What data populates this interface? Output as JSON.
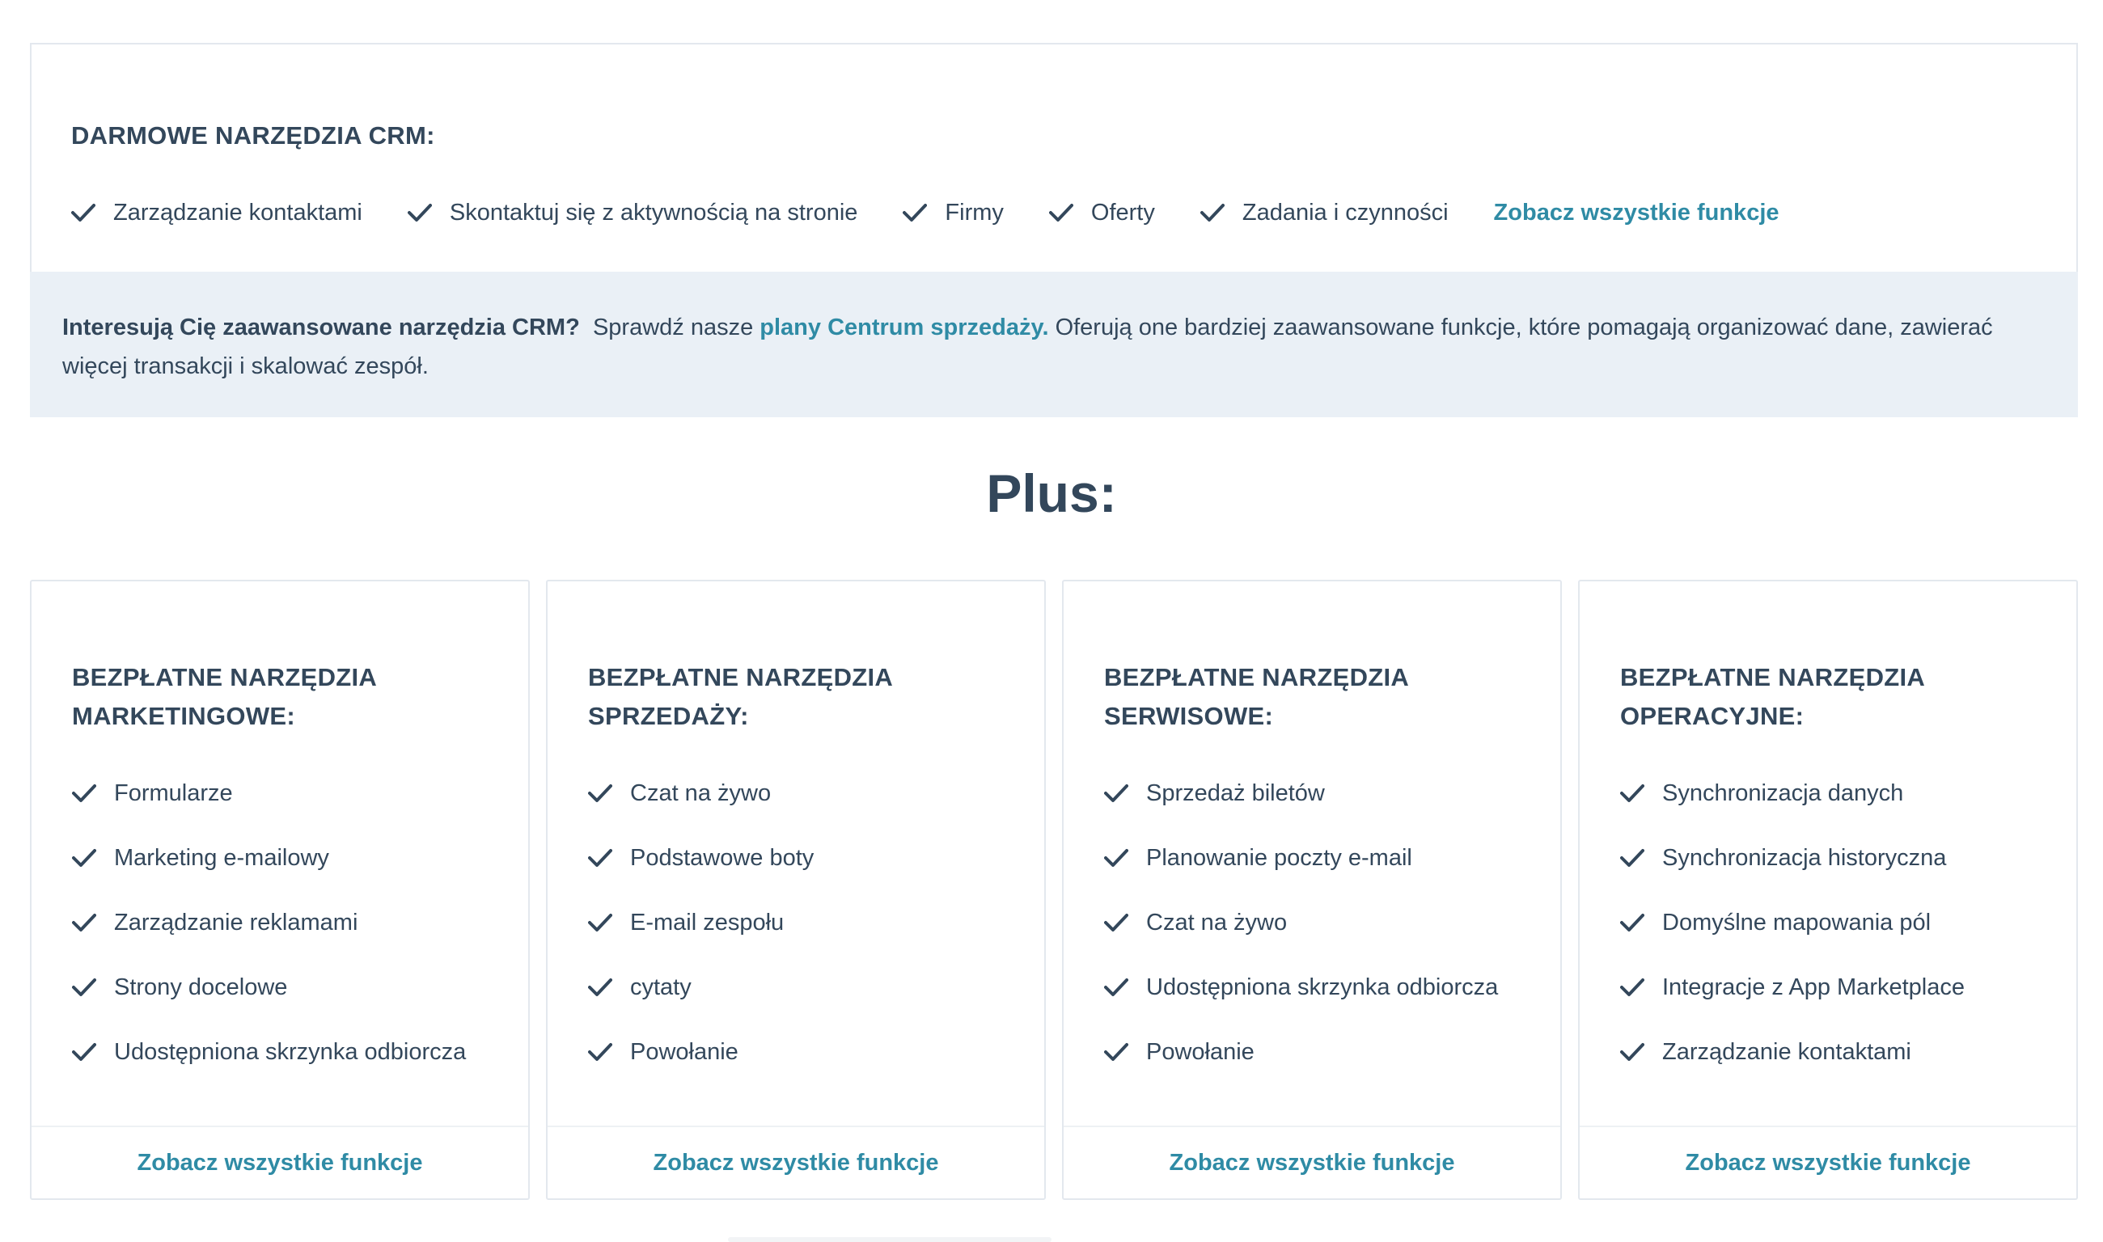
{
  "crm": {
    "title": "DARMOWE NARZĘDZIA CRM:",
    "features": [
      "Zarządzanie kontaktami",
      "Skontaktuj się z aktywnością na stronie",
      "Firmy",
      "Oferty",
      "Zadania i czynności"
    ],
    "see_all": "Zobacz wszystkie funkcje"
  },
  "info": {
    "lead": "Interesują Cię zaawansowane narzędzia CRM?",
    "text_before_link": "Sprawdź nasze",
    "link": "plany Centrum sprzedaży.",
    "text_after_link": "Oferują one bardziej zaawansowane funkcje, które pomagają organizować dane, zawierać więcej transakcji i skalować zespół."
  },
  "plus": {
    "heading": "Plus:"
  },
  "cards": [
    {
      "title": "BEZPŁATNE NARZĘDZIA MARKETINGOWE:",
      "items": [
        "Formularze",
        "Marketing e-mailowy",
        "Zarządzanie reklamami",
        "Strony docelowe",
        "Udostępniona skrzynka odbiorcza"
      ],
      "see_all": "Zobacz wszystkie funkcje"
    },
    {
      "title": "BEZPŁATNE NARZĘDZIA SPRZEDAŻY:",
      "items": [
        "Czat na żywo",
        "Podstawowe boty",
        "E-mail zespołu",
        "cytaty",
        "Powołanie"
      ],
      "see_all": "Zobacz wszystkie funkcje"
    },
    {
      "title": "BEZPŁATNE NARZĘDZIA SERWISOWE:",
      "items": [
        "Sprzedaż biletów",
        "Planowanie poczty e-mail",
        "Czat na żywo",
        "Udostępniona skrzynka odbiorcza",
        "Powołanie"
      ],
      "see_all": "Zobacz wszystkie funkcje"
    },
    {
      "title": "BEZPŁATNE NARZĘDZIA OPERACYJNE:",
      "items": [
        "Synchronizacja danych",
        "Synchronizacja historyczna",
        "Domyślne mapowania pól",
        "Integracje z App Marketplace",
        "Zarządzanie kontaktami"
      ],
      "see_all": "Zobacz wszystkie funkcje"
    }
  ],
  "colors": {
    "text": "#33475b",
    "link": "#2f8ba5",
    "band": "#eaf0f6",
    "border": "#e3e8ee"
  },
  "icons": {
    "feature": "checkmark-icon"
  }
}
